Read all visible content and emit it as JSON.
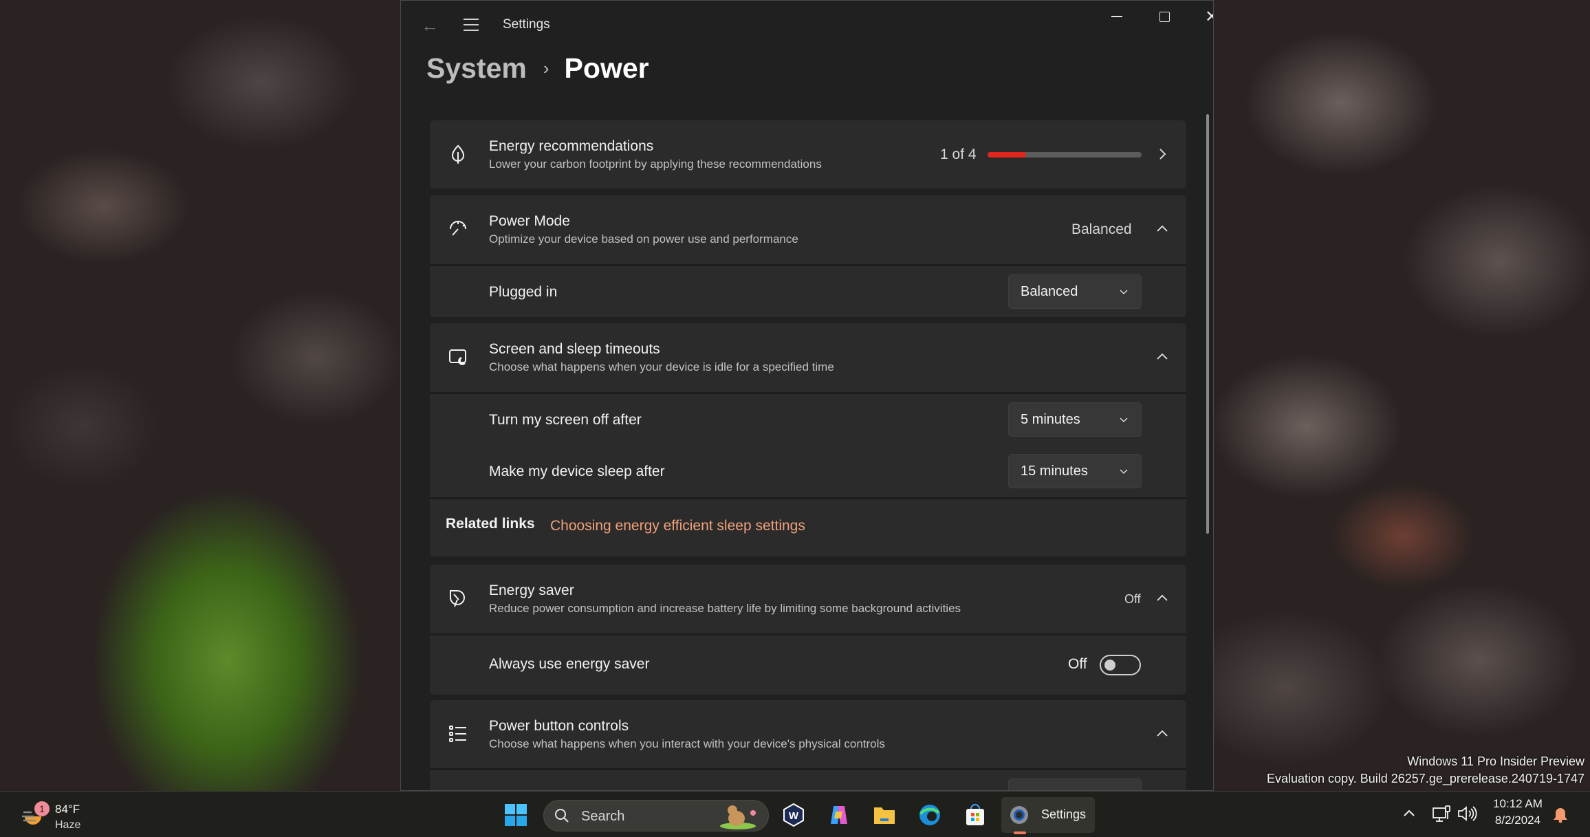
{
  "window": {
    "app_title": "Settings",
    "controls": {
      "minimize": "minimize",
      "maximize": "maximize",
      "close": "close"
    }
  },
  "breadcrumb": {
    "parent": "System",
    "separator": "›",
    "current": "Power"
  },
  "sections": {
    "energy_recommendations": {
      "title": "Energy recommendations",
      "subtitle": "Lower your carbon footprint by applying these recommendations",
      "progress_text": "1 of 4",
      "progress_fraction": 0.25,
      "progress_color": "#e0261f",
      "icon": "leaf-icon"
    },
    "power_mode": {
      "title": "Power Mode",
      "subtitle": "Optimize your device based on power use and performance",
      "value": "Balanced",
      "expanded": true,
      "icon": "gauge-icon",
      "rows": [
        {
          "label": "Plugged in",
          "selected": "Balanced"
        }
      ]
    },
    "screen_sleep": {
      "title": "Screen and sleep timeouts",
      "subtitle": "Choose what happens when your device is idle for a specified time",
      "expanded": true,
      "icon": "screen-sleep-icon",
      "rows": [
        {
          "label": "Turn my screen off after",
          "selected": "5 minutes"
        },
        {
          "label": "Make my device sleep after",
          "selected": "15 minutes"
        }
      ],
      "related_label": "Related links",
      "related_link": "Choosing energy efficient sleep settings",
      "link_color": "#f0a07a"
    },
    "energy_saver": {
      "title": "Energy saver",
      "subtitle": "Reduce power consumption and increase battery life by limiting some background activities",
      "value": "Off",
      "expanded": true,
      "icon": "energy-saver-icon",
      "always_label": "Always use energy saver",
      "toggle_state": "Off"
    },
    "power_button": {
      "title": "Power button controls",
      "subtitle": "Choose what happens when you interact with your device's physical controls",
      "expanded": true,
      "icon": "list-controls-icon"
    }
  },
  "desktop": {
    "watermark_line1": "Windows 11 Pro Insider Preview",
    "watermark_line2": "Evaluation copy. Build 26257.ge_prerelease.240719-1747"
  },
  "taskbar": {
    "weather": {
      "temp": "84°F",
      "condition": "Haze",
      "badge": "1"
    },
    "search_placeholder": "Search",
    "apps": [
      "start",
      "wordpad-w",
      "copilot",
      "file-explorer",
      "edge",
      "microsoft-store",
      "settings"
    ],
    "active_app_label": "Settings",
    "clock_time": "10:12 AM",
    "clock_date": "8/2/2024"
  }
}
